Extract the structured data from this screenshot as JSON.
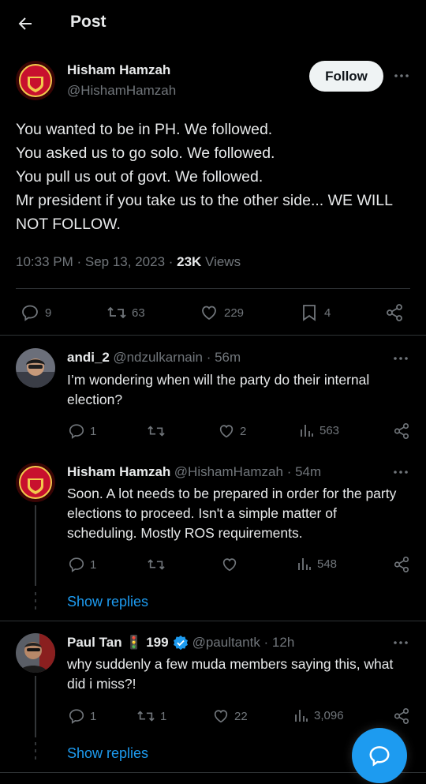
{
  "header": {
    "title": "Post"
  },
  "post": {
    "author_name": "Hisham Hamzah",
    "author_handle": "@HishamHamzah",
    "follow_label": "Follow",
    "text": "You wanted to be in PH. We followed.\nYou asked us to go solo. We followed.\nYou pull us out of govt. We followed.\nMr president if you take us to the other side... WE WILL NOT FOLLOW.",
    "time": "10:33 PM · Sep 13, 2023 · ",
    "views_count": "23K",
    "views_label": " Views",
    "replies": "9",
    "reposts": "63",
    "likes": "229",
    "bookmarks": "4"
  },
  "replies": [
    {
      "name": "andi_2",
      "handle": "@ndzulkarnain · 56m",
      "text": "I’m wondering when will the party do their internal election?",
      "replies": "1",
      "reposts": "",
      "likes": "2",
      "views": "563"
    },
    {
      "name": "Hisham Hamzah",
      "handle": "@HishamHamzah · 54m",
      "text": "Soon. A lot needs to be prepared in order for the party elections to proceed. Isn't a simple matter of scheduling. Mostly ROS requirements.",
      "replies": "1",
      "reposts": "",
      "likes": "",
      "views": "548",
      "show_replies": "Show replies"
    },
    {
      "name": "Paul Tan 🚦 199",
      "handle": "@paultantk · 12h",
      "text": "why suddenly a few muda members saying this, what did i miss?!",
      "replies": "1",
      "reposts": "1",
      "likes": "22",
      "views": "3,096",
      "show_replies": "Show replies"
    }
  ],
  "colors": {
    "accent": "#1d9bf0",
    "background": "#000000",
    "muted": "#71767b",
    "text": "#e7e9ea",
    "verified": "#1d9bf0"
  },
  "icons": [
    "back-arrow-icon",
    "more-icon",
    "reply-icon",
    "repost-icon",
    "like-icon",
    "bookmark-icon",
    "share-icon",
    "views-icon",
    "verified-badge-icon",
    "compose-reply-icon"
  ]
}
